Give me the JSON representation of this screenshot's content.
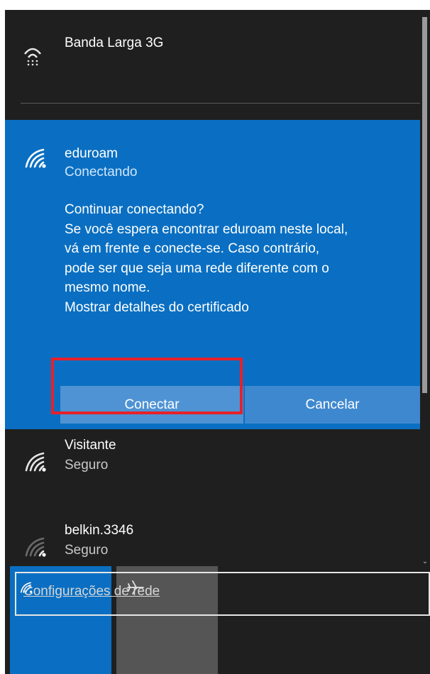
{
  "networks": [
    {
      "name": "Banda Larga 3G",
      "status": "",
      "icon": "cellular-icon"
    },
    {
      "name": "eduroam",
      "status": "Conectando",
      "icon": "wifi-icon"
    },
    {
      "name": "Visitante",
      "status": "Seguro",
      "icon": "wifi-icon"
    },
    {
      "name": "belkin.3346",
      "status": "Seguro",
      "icon": "wifi-icon"
    }
  ],
  "prompt": {
    "lines": [
      "Continuar conectando?",
      "Se você espera encontrar eduroam neste local,",
      "vá em frente e conecte-se. Caso contrário,",
      "pode ser que seja uma rede diferente com o",
      "mesmo nome.",
      "Mostrar detalhes do certificado"
    ],
    "connect_label": "Conectar",
    "cancel_label": "Cancelar"
  },
  "settings": {
    "label": "Configurações de rede"
  },
  "quick_actions": [
    {
      "icon": "wifi-icon",
      "state": "on"
    },
    {
      "icon": "airplane-icon",
      "state": "off"
    }
  ],
  "colors": {
    "panel_bg": "#1f1f1f",
    "accent": "#0a6fc2",
    "button_connect": "#4f93d4",
    "button_cancel": "#3e88cf",
    "highlight": "#e8202a"
  }
}
